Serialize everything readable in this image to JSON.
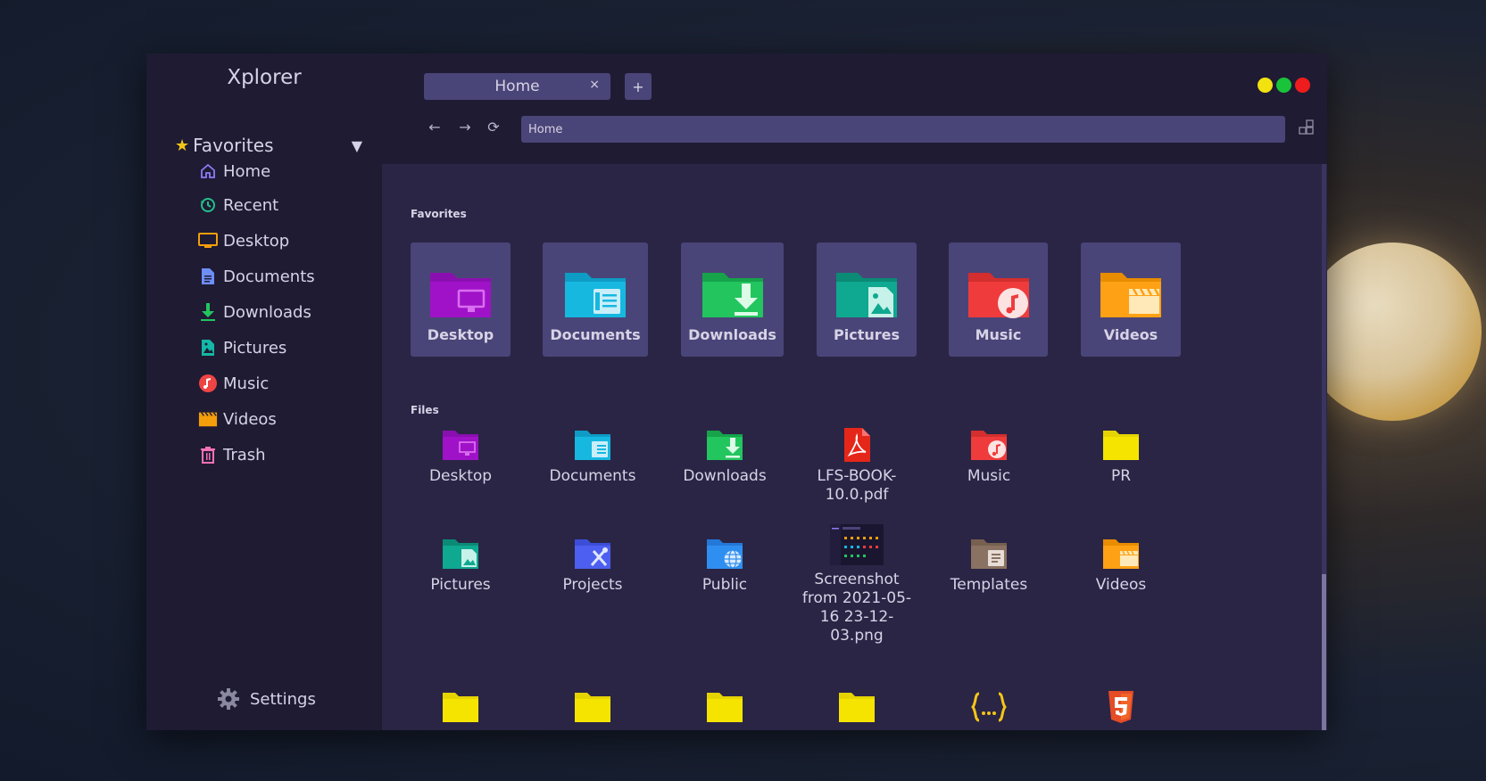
{
  "app": {
    "title": "Xplorer"
  },
  "window_controls": {
    "colors": {
      "minimize": "#f2e20f",
      "maximize": "#19c33a",
      "close": "#ee1c1c"
    }
  },
  "tab": {
    "label": "Home",
    "close": "×",
    "new_tab": "+"
  },
  "navigation": {
    "back": "←",
    "forward": "→",
    "reload": "⟳"
  },
  "address_bar": {
    "value": "Home"
  },
  "sidebar": {
    "favorites_label": "Favorites",
    "favorites_star": "★",
    "caret": "▼",
    "items": [
      {
        "label": "Home",
        "icon": "home-icon",
        "color": "#8b7cf6"
      },
      {
        "label": "Recent",
        "icon": "history-icon",
        "color": "#22c08a"
      },
      {
        "label": "Desktop",
        "icon": "desktop-icon",
        "color": "#f59e0b"
      },
      {
        "label": "Documents",
        "icon": "document-icon",
        "color": "#6d8ef5"
      },
      {
        "label": "Downloads",
        "icon": "download-icon",
        "color": "#22c55e"
      },
      {
        "label": "Pictures",
        "icon": "picture-icon",
        "color": "#14b8a6"
      },
      {
        "label": "Music",
        "icon": "music-icon",
        "color": "#ef4444"
      },
      {
        "label": "Videos",
        "icon": "video-icon",
        "color": "#f59e0b"
      },
      {
        "label": "Trash",
        "icon": "trash-icon",
        "color": "#f472b6"
      }
    ],
    "settings_label": "Settings"
  },
  "main": {
    "favorites_title": "Favorites",
    "files_title": "Files",
    "favorites": [
      {
        "label": "Desktop",
        "icon": "desktop-folder-icon",
        "color": "#a012c8"
      },
      {
        "label": "Documents",
        "icon": "documents-folder-icon",
        "color": "#16b8e0"
      },
      {
        "label": "Downloads",
        "icon": "downloads-folder-icon",
        "color": "#22c55e"
      },
      {
        "label": "Pictures",
        "icon": "pictures-folder-icon",
        "color": "#0fa890"
      },
      {
        "label": "Music",
        "icon": "music-folder-icon",
        "color": "#ef3b3b"
      },
      {
        "label": "Videos",
        "icon": "videos-folder-icon",
        "color": "#ffa114"
      }
    ],
    "files": [
      {
        "label": "Desktop",
        "icon": "desktop-folder-icon",
        "color": "#a012c8"
      },
      {
        "label": "Documents",
        "icon": "documents-folder-icon",
        "color": "#16b8e0"
      },
      {
        "label": "Downloads",
        "icon": "downloads-folder-icon",
        "color": "#22c55e"
      },
      {
        "label": "LFS-BOOK-10.0.pdf",
        "icon": "pdf-file-icon",
        "color": "#e5271a"
      },
      {
        "label": "Music",
        "icon": "music-folder-icon",
        "color": "#ef3b3b"
      },
      {
        "label": "PR",
        "icon": "folder-icon",
        "color": "#f5e400"
      },
      {
        "label": "Pictures",
        "icon": "pictures-folder-icon",
        "color": "#0fa890"
      },
      {
        "label": "Projects",
        "icon": "projects-folder-icon",
        "color": "#4c5ff0"
      },
      {
        "label": "Public",
        "icon": "public-folder-icon",
        "color": "#2f8ff0"
      },
      {
        "label": "Screenshot from 2021-05-16 23-12-03.png",
        "icon": "image-thumbnail-icon",
        "color": "#1a1630"
      },
      {
        "label": "Templates",
        "icon": "templates-folder-icon",
        "color": "#8a7262"
      },
      {
        "label": "Videos",
        "icon": "videos-folder-icon",
        "color": "#ffa114"
      },
      {
        "label": "",
        "icon": "folder-icon",
        "color": "#f5e400"
      },
      {
        "label": "",
        "icon": "folder-icon",
        "color": "#f5e400"
      },
      {
        "label": "",
        "icon": "folder-icon",
        "color": "#f5e400"
      },
      {
        "label": "",
        "icon": "folder-icon",
        "color": "#f5e400"
      },
      {
        "label": "",
        "icon": "json-file-icon",
        "color": "#f5c518"
      },
      {
        "label": "",
        "icon": "html5-file-icon",
        "color": "#e44d26"
      }
    ]
  }
}
